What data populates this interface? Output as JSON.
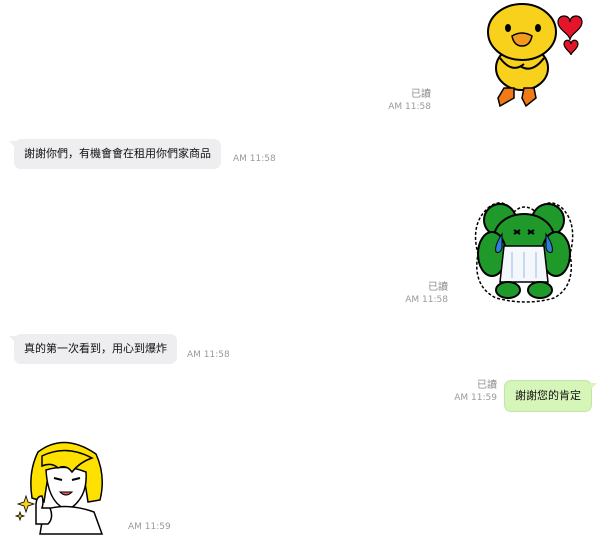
{
  "messages": [
    {
      "id": "m1",
      "side": "out",
      "type": "sticker",
      "sticker": "duck-hearts-sticker",
      "read": "已讀",
      "time": "AM 11:58"
    },
    {
      "id": "m2",
      "side": "in",
      "type": "text",
      "text": "謝謝你們，有機會會在租用你們家商品",
      "time": "AM 11:58"
    },
    {
      "id": "m3",
      "side": "out",
      "type": "sticker",
      "sticker": "green-frog-crying-sticker",
      "read": "已讀",
      "time": "AM 11:58"
    },
    {
      "id": "m4",
      "side": "in",
      "type": "text",
      "text": "真的第一次看到，用心到爆炸",
      "time": "AM 11:58"
    },
    {
      "id": "m5",
      "side": "out",
      "type": "text",
      "text": "謝謝您的肯定",
      "read": "已讀",
      "time": "AM 11:59"
    },
    {
      "id": "m6",
      "side": "in",
      "type": "sticker",
      "sticker": "girl-thumbs-up-sticker",
      "time": "AM 11:59"
    }
  ],
  "colors": {
    "outgoing_bubble": "#d6f5b8",
    "incoming_bubble": "#eeeef1",
    "meta_text": "#9a9a9a"
  }
}
